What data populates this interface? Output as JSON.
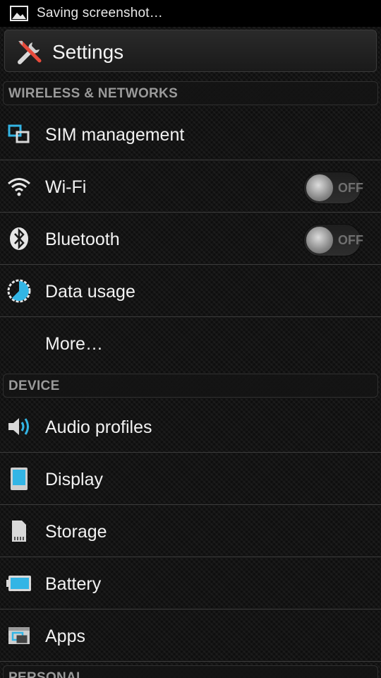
{
  "status_bar": {
    "text": "Saving screenshot…",
    "icon": "image-icon"
  },
  "action_bar": {
    "title": "Settings",
    "icon": "settings-tools-icon"
  },
  "sections": {
    "wireless": {
      "label": "WIRELESS & NETWORKS"
    },
    "device": {
      "label": "DEVICE"
    },
    "personal": {
      "label": "PERSONAL"
    }
  },
  "items": {
    "sim": {
      "label": "SIM management",
      "icon": "sim-management-icon"
    },
    "wifi": {
      "label": "Wi-Fi",
      "icon": "wifi-icon",
      "toggle": "OFF"
    },
    "bluetooth": {
      "label": "Bluetooth",
      "icon": "bluetooth-icon",
      "toggle": "OFF"
    },
    "data_usage": {
      "label": "Data usage",
      "icon": "data-usage-icon"
    },
    "more": {
      "label": "More…"
    },
    "audio": {
      "label": "Audio profiles",
      "icon": "speaker-icon"
    },
    "display": {
      "label": "Display",
      "icon": "display-icon"
    },
    "storage": {
      "label": "Storage",
      "icon": "storage-icon"
    },
    "battery": {
      "label": "Battery",
      "icon": "battery-icon"
    },
    "apps": {
      "label": "Apps",
      "icon": "apps-icon"
    }
  },
  "colors": {
    "accent": "#33b5e5",
    "background": "#141414",
    "divider": "#3c3c3c"
  }
}
